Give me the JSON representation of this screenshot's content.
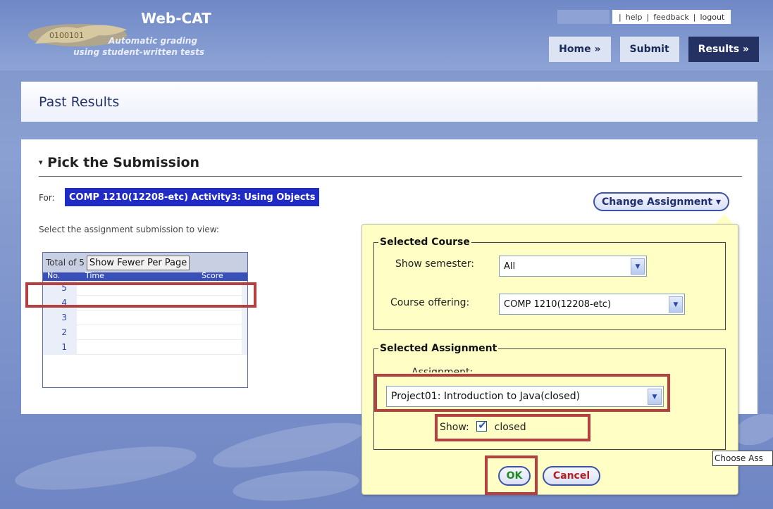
{
  "header": {
    "app_name": "Web-CAT",
    "tagline_line1": "Automatic grading",
    "tagline_line2": "using student-written tests",
    "links": [
      "help",
      "feedback",
      "logout"
    ],
    "nav": [
      {
        "label": "Home »"
      },
      {
        "label": "Submit"
      },
      {
        "label": "Results »"
      }
    ]
  },
  "page_title": "Past Results",
  "section": {
    "title": "Pick the Submission",
    "for_label": "For:",
    "for_value": "COMP 1210(12208-etc) Activity3: Using Objects",
    "select_help": "Select the assignment submission to view:",
    "change_button": "Change Assignment ▾"
  },
  "table": {
    "total_label": "Total of 5",
    "toggle_button": "Show Fewer Per Page",
    "columns": [
      "No.",
      "Time",
      "Score"
    ],
    "rows": [
      "5",
      "4",
      "3",
      "2",
      "1"
    ]
  },
  "popup": {
    "course_legend": "Selected Course",
    "semester_label": "Show semester:",
    "semester_value": "All",
    "offering_label": "Course offering:",
    "offering_value": "COMP 1210(12208-etc)",
    "assignment_legend": "Selected Assignment",
    "assignment_label": "Assignment:",
    "assignment_value": "Project01: Introduction to Java(closed)",
    "show_label": "Show:",
    "show_option": "closed",
    "ok": "OK",
    "cancel": "Cancel"
  },
  "tooltip": "Choose Ass",
  "colors": {
    "accent": "#1f2bc4",
    "nav_dark": "#233262",
    "highlight": "#b5403f",
    "popup_bg": "#ffffc5"
  }
}
